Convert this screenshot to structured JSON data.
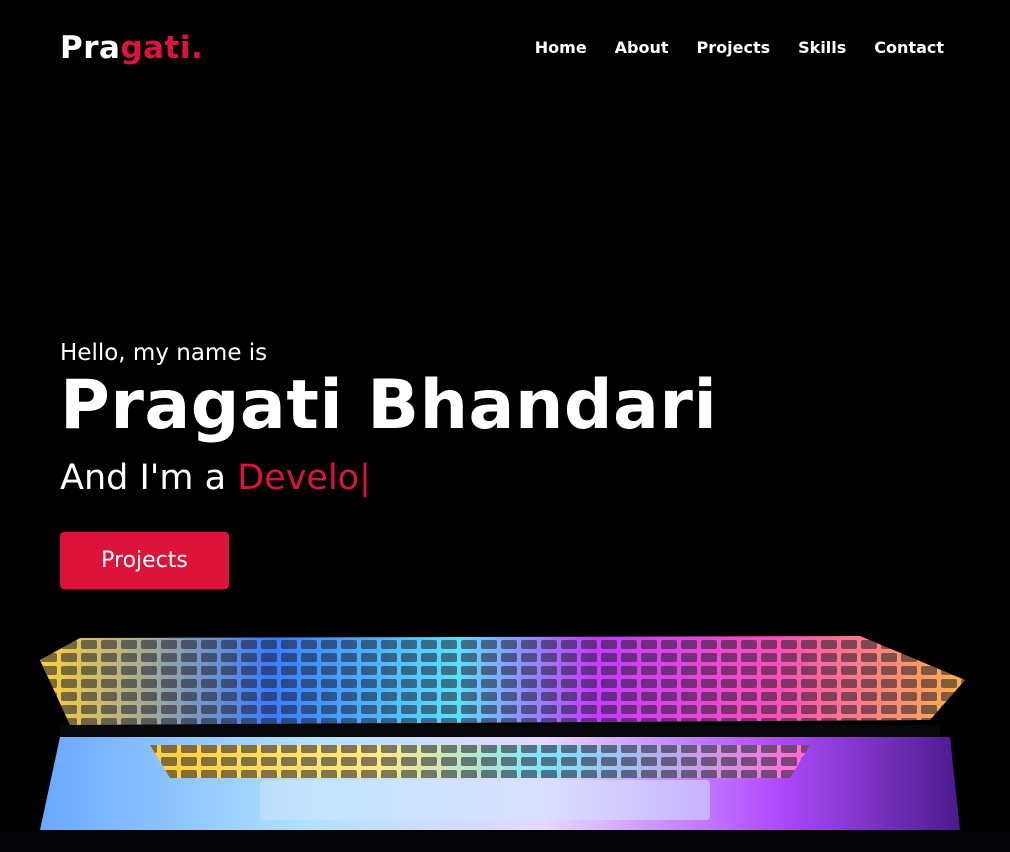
{
  "logo": {
    "main": "Pra",
    "accent": "gati."
  },
  "nav": {
    "items": [
      "Home",
      "About",
      "Projects",
      "Skills",
      "Contact"
    ]
  },
  "hero": {
    "greeting": "Hello, my name is",
    "name": "Pragati Bhandari",
    "role_prefix": "And I'm a ",
    "role_typed": "Develo",
    "cursor": "|",
    "button": "Projects"
  },
  "colors": {
    "accent": "#dc143c",
    "background": "#000000"
  }
}
